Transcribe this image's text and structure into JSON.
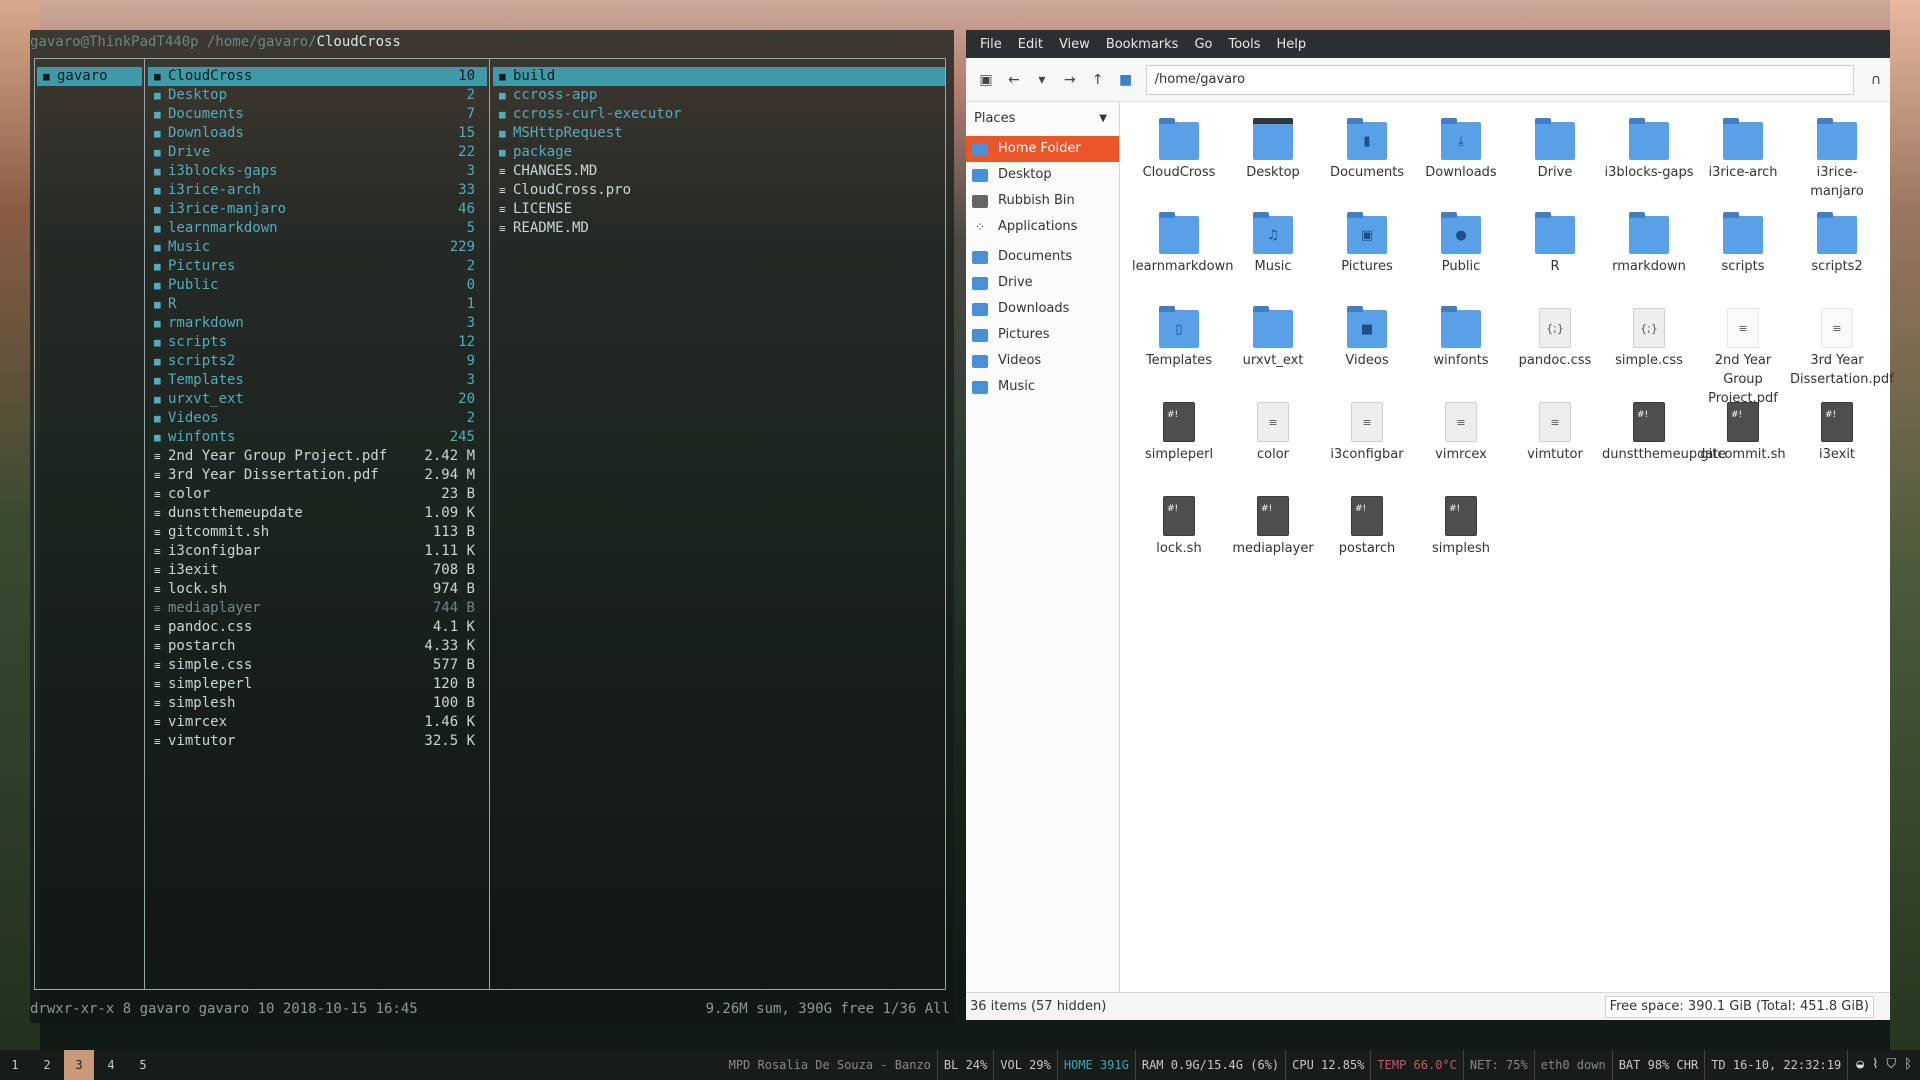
{
  "terminal": {
    "title_prefix": "gavaro@ThinkPadT440p /home/gavaro/",
    "title_dir": "CloudCross",
    "parent_col": [
      {
        "name": "gavaro",
        "selected": true
      }
    ],
    "current_col": [
      {
        "name": "CloudCross",
        "size": "10",
        "type": "dir",
        "selected": true
      },
      {
        "name": "Desktop",
        "size": "2",
        "type": "dir"
      },
      {
        "name": "Documents",
        "size": "7",
        "type": "dir"
      },
      {
        "name": "Downloads",
        "size": "15",
        "type": "dir"
      },
      {
        "name": "Drive",
        "size": "22",
        "type": "dir"
      },
      {
        "name": "i3blocks-gaps",
        "size": "3",
        "type": "dir"
      },
      {
        "name": "i3rice-arch",
        "size": "33",
        "type": "dir"
      },
      {
        "name": "i3rice-manjaro",
        "size": "46",
        "type": "dir"
      },
      {
        "name": "learnmarkdown",
        "size": "5",
        "type": "dir"
      },
      {
        "name": "Music",
        "size": "229",
        "type": "dir"
      },
      {
        "name": "Pictures",
        "size": "2",
        "type": "dir"
      },
      {
        "name": "Public",
        "size": "0",
        "type": "dir"
      },
      {
        "name": "R",
        "size": "1",
        "type": "dir"
      },
      {
        "name": "rmarkdown",
        "size": "3",
        "type": "dir"
      },
      {
        "name": "scripts",
        "size": "12",
        "type": "dir"
      },
      {
        "name": "scripts2",
        "size": "9",
        "type": "dir"
      },
      {
        "name": "Templates",
        "size": "3",
        "type": "dir"
      },
      {
        "name": "urxvt_ext",
        "size": "20",
        "type": "dir"
      },
      {
        "name": "Videos",
        "size": "2",
        "type": "dir"
      },
      {
        "name": "winfonts",
        "size": "245",
        "type": "dir"
      },
      {
        "name": "2nd Year Group Project.pdf",
        "size": "2.42 M",
        "type": "file"
      },
      {
        "name": "3rd Year Dissertation.pdf",
        "size": "2.94 M",
        "type": "file"
      },
      {
        "name": "color",
        "size": "23 B",
        "type": "file"
      },
      {
        "name": "dunstthemeupdate",
        "size": "1.09 K",
        "type": "file"
      },
      {
        "name": "gitcommit.sh",
        "size": "113 B",
        "type": "file"
      },
      {
        "name": "i3configbar",
        "size": "1.11 K",
        "type": "file"
      },
      {
        "name": "i3exit",
        "size": "708 B",
        "type": "file"
      },
      {
        "name": "lock.sh",
        "size": "974 B",
        "type": "file"
      },
      {
        "name": "mediaplayer",
        "size": "744 B",
        "type": "dim"
      },
      {
        "name": "pandoc.css",
        "size": "4.1 K",
        "type": "file"
      },
      {
        "name": "postarch",
        "size": "4.33 K",
        "type": "file"
      },
      {
        "name": "simple.css",
        "size": "577 B",
        "type": "file"
      },
      {
        "name": "simpleperl",
        "size": "120 B",
        "type": "file"
      },
      {
        "name": "simplesh",
        "size": "100 B",
        "type": "file"
      },
      {
        "name": "vimrcex",
        "size": "1.46 K",
        "type": "file"
      },
      {
        "name": "vimtutor",
        "size": "32.5 K",
        "type": "file"
      }
    ],
    "preview_col": [
      {
        "name": "build",
        "type": "dir",
        "selected": true
      },
      {
        "name": "ccross-app",
        "type": "dir"
      },
      {
        "name": "ccross-curl-executor",
        "type": "dir"
      },
      {
        "name": "MSHttpRequest",
        "type": "dir"
      },
      {
        "name": "package",
        "type": "dir"
      },
      {
        "name": "CHANGES.MD",
        "type": "file"
      },
      {
        "name": "CloudCross.pro",
        "type": "file"
      },
      {
        "name": "LICENSE",
        "type": "file"
      },
      {
        "name": "README.MD",
        "type": "file"
      }
    ],
    "status_left": "drwxr-xr-x 8 gavaro gavaro 10 2018-10-15 16:45",
    "status_right": "9.26M sum, 390G free  1/36  All"
  },
  "file_manager": {
    "menu": [
      "File",
      "Edit",
      "View",
      "Bookmarks",
      "Go",
      "Tools",
      "Help"
    ],
    "location": "/home/gavaro",
    "places_header": "Places",
    "places": [
      {
        "label": "Home Folder",
        "active": true,
        "icon": "home-icon"
      },
      {
        "label": "Desktop",
        "icon": "desktop-icon"
      },
      {
        "label": "Rubbish Bin",
        "icon": "trash-icon"
      },
      {
        "label": "Applications",
        "icon": "apps-icon"
      }
    ],
    "bookmarks": [
      {
        "label": "Documents",
        "icon": "folder-icon"
      },
      {
        "label": "Drive",
        "icon": "folder-icon"
      },
      {
        "label": "Downloads",
        "icon": "folder-icon"
      },
      {
        "label": "Pictures",
        "icon": "folder-icon"
      },
      {
        "label": "Videos",
        "icon": "folder-icon"
      },
      {
        "label": "Music",
        "icon": "folder-icon"
      }
    ],
    "items": [
      {
        "label": "CloudCross",
        "kind": "folder"
      },
      {
        "label": "Desktop",
        "kind": "folder-dark"
      },
      {
        "label": "Documents",
        "kind": "folder",
        "glyph": "▮"
      },
      {
        "label": "Downloads",
        "kind": "folder",
        "glyph": "⤓"
      },
      {
        "label": "Drive",
        "kind": "folder"
      },
      {
        "label": "i3blocks-gaps",
        "kind": "folder"
      },
      {
        "label": "i3rice-arch",
        "kind": "folder"
      },
      {
        "label": "i3rice-manjaro",
        "kind": "folder"
      },
      {
        "label": "learnmarkdown",
        "kind": "folder"
      },
      {
        "label": "Music",
        "kind": "folder",
        "glyph": "♫"
      },
      {
        "label": "Pictures",
        "kind": "folder",
        "glyph": "▣"
      },
      {
        "label": "Public",
        "kind": "folder",
        "glyph": "●"
      },
      {
        "label": "R",
        "kind": "folder"
      },
      {
        "label": "rmarkdown",
        "kind": "folder"
      },
      {
        "label": "scripts",
        "kind": "folder"
      },
      {
        "label": "scripts2",
        "kind": "folder"
      },
      {
        "label": "Templates",
        "kind": "folder",
        "glyph": "▯"
      },
      {
        "label": "urxvt_ext",
        "kind": "folder"
      },
      {
        "label": "Videos",
        "kind": "folder",
        "glyph": "■"
      },
      {
        "label": "winfonts",
        "kind": "folder"
      },
      {
        "label": "pandoc.css",
        "kind": "doc",
        "glyph": "{;}"
      },
      {
        "label": "simple.css",
        "kind": "doc",
        "glyph": "{;}"
      },
      {
        "label": "2nd Year Group Project.pdf",
        "kind": "pdf"
      },
      {
        "label": "3rd Year Dissertation.pdf",
        "kind": "pdf"
      },
      {
        "label": "simpleperl",
        "kind": "script",
        "glyph": "#!"
      },
      {
        "label": "color",
        "kind": "doc",
        "glyph": "≡"
      },
      {
        "label": "i3configbar",
        "kind": "doc",
        "glyph": "≡"
      },
      {
        "label": "vimrcex",
        "kind": "doc",
        "glyph": "≡"
      },
      {
        "label": "vimtutor",
        "kind": "doc",
        "glyph": "≡"
      },
      {
        "label": "dunstthemeupdate",
        "kind": "script",
        "glyph": "#!"
      },
      {
        "label": "gitcommit.sh",
        "kind": "script",
        "glyph": "#!"
      },
      {
        "label": "i3exit",
        "kind": "script",
        "glyph": "#!"
      },
      {
        "label": "lock.sh",
        "kind": "script",
        "glyph": "#!"
      },
      {
        "label": "mediaplayer",
        "kind": "script",
        "glyph": "#!"
      },
      {
        "label": "postarch",
        "kind": "script",
        "glyph": "#!"
      },
      {
        "label": "simplesh",
        "kind": "script",
        "glyph": "#!"
      }
    ],
    "status_count": "36 items (57 hidden)",
    "status_free": "Free space: 390.1 GiB (Total: 451.8 GiB)"
  },
  "bar": {
    "workspaces": [
      {
        "label": "1"
      },
      {
        "label": "2"
      },
      {
        "label": "3",
        "active": true
      },
      {
        "label": "4"
      },
      {
        "label": "5"
      }
    ],
    "blocks": [
      {
        "text": "MPD Rosalia De Souza - Banzo",
        "style": "muted"
      },
      {
        "text": "BL 24%",
        "style": ""
      },
      {
        "text": "VOL 29%",
        "style": ""
      },
      {
        "text": "HOME 391G",
        "style": "accent"
      },
      {
        "text": "RAM 0.9G/15.4G (6%)",
        "style": ""
      },
      {
        "text": "CPU 12.85%",
        "style": ""
      },
      {
        "text": "TEMP 66.0°C",
        "style": "warn"
      },
      {
        "text": "NET: 75%",
        "style": "muted"
      },
      {
        "text": "eth0 down",
        "style": "muted"
      },
      {
        "text": "BAT 98% CHR",
        "style": ""
      },
      {
        "text": "TD 16-10, 22:32:19",
        "style": ""
      }
    ]
  },
  "colors": {
    "accent": "#3f9aa8",
    "places_active": "#e8562a",
    "folder": "#5aa0e6",
    "workspace_active": "#c9997a"
  }
}
